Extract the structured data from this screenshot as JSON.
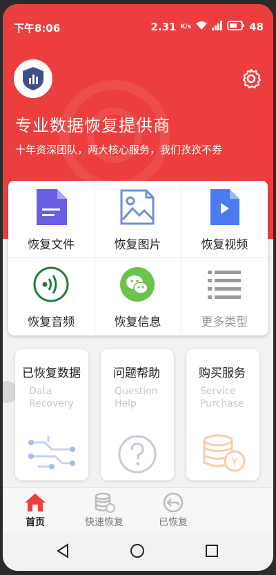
{
  "status_bar": {
    "time": "下午8:06",
    "right_text": "2.31",
    "unit": "K/s",
    "battery": "48"
  },
  "header": {
    "title": "专业数据恢复提供商",
    "subtitle": "十年资深团队，两大核心服务，我们孜孜不券"
  },
  "grid": {
    "items": [
      {
        "label": "恢复文件",
        "icon": "file-icon"
      },
      {
        "label": "恢复图片",
        "icon": "image-icon"
      },
      {
        "label": "恢复视频",
        "icon": "video-icon"
      },
      {
        "label": "恢复音频",
        "icon": "audio-icon"
      },
      {
        "label": "恢复信息",
        "icon": "wechat-icon"
      },
      {
        "label": "更多类型",
        "icon": "list-icon"
      }
    ]
  },
  "cards": [
    {
      "title": "已恢复数据",
      "sub1": "Data",
      "sub2": "Recovery"
    },
    {
      "title": "问题帮助",
      "sub1": "Question",
      "sub2": "Help"
    },
    {
      "title": "购买服务",
      "sub1": "Service",
      "sub2": "Purchase"
    }
  ],
  "tabbar": {
    "tabs": [
      {
        "label": "首页"
      },
      {
        "label": "快速恢复"
      },
      {
        "label": "已恢复"
      }
    ]
  },
  "colors": {
    "brand_red": "#ec3f3d",
    "file_purple": "#6a5fe0",
    "video_blue": "#4a7bf0",
    "wechat_green": "#6cc24a"
  }
}
